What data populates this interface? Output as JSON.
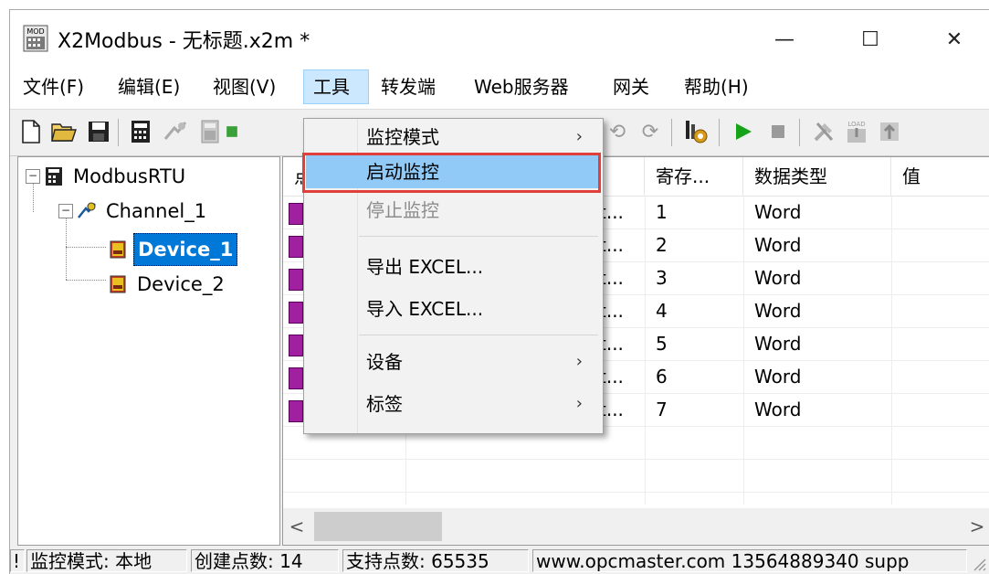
{
  "window": {
    "title": "X2Modbus - 无标题.x2m *",
    "icon_text": "MOD",
    "controls": {
      "minimize": "—",
      "maximize": "☐",
      "close": "✕"
    }
  },
  "menubar": {
    "items": [
      "文件(F)",
      "编辑(E)",
      "视图(V)",
      "工具",
      "转发端",
      "Web服务器",
      "网关",
      "帮助(H)"
    ]
  },
  "toolbar": {
    "icons": [
      "new-file-icon",
      "open-folder-icon",
      "save-icon",
      "device-icon",
      "channel-icon",
      "device2-icon",
      "tag-icon",
      "undo-icon",
      "redo-icon",
      "monitor-icon",
      "run-icon",
      "stop-icon",
      "tools-icon",
      "load-icon",
      "upload-icon"
    ],
    "load_text": "LOAD",
    "run_color": "#17a317"
  },
  "tree": {
    "root": "ModbusRTU",
    "channel": "Channel_1",
    "devices": [
      "Device_1",
      "Device_2"
    ],
    "selected": "Device_1"
  },
  "list": {
    "columns": [
      "点",
      "寄存...",
      "数据类型",
      "值"
    ],
    "partial_name": "t...",
    "rows": [
      {
        "name": "t...",
        "reg": "1",
        "type": "Word",
        "value": ""
      },
      {
        "name": "t...",
        "reg": "2",
        "type": "Word",
        "value": ""
      },
      {
        "name": "t...",
        "reg": "3",
        "type": "Word",
        "value": ""
      },
      {
        "name": "t...",
        "reg": "4",
        "type": "Word",
        "value": ""
      },
      {
        "name": "t...",
        "reg": "5",
        "type": "Word",
        "value": ""
      },
      {
        "name": "t...",
        "reg": "6",
        "type": "Word",
        "value": ""
      },
      {
        "name": "t...",
        "reg": "7",
        "type": "Word",
        "value": ""
      }
    ]
  },
  "dropdown": {
    "items": [
      {
        "label": "监控模式",
        "submenu": true,
        "state": "normal"
      },
      {
        "label": "启动监控",
        "submenu": false,
        "state": "highlighted"
      },
      {
        "label": "停止监控",
        "submenu": false,
        "state": "disabled"
      },
      {
        "label": "导出 EXCEL...",
        "submenu": false,
        "state": "normal"
      },
      {
        "label": "导入 EXCEL...",
        "submenu": false,
        "state": "normal"
      },
      {
        "label": "设备",
        "submenu": true,
        "state": "normal"
      },
      {
        "label": "标签",
        "submenu": true,
        "state": "normal"
      }
    ],
    "highlight_border_color": "#e0403c"
  },
  "scrollbar": {
    "left": "<",
    "right": ">"
  },
  "statusbar": {
    "panes": [
      "!",
      "监控模式: 本地",
      "创建点数: 14",
      "支持点数: 65535",
      "www.opcmaster.com 13564889340 supp"
    ]
  }
}
